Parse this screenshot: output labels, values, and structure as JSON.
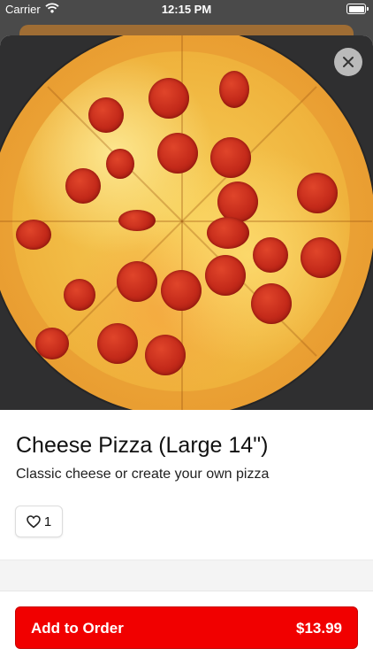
{
  "status_bar": {
    "carrier": "Carrier",
    "time": "12:15 PM",
    "icons": [
      "wifi-icon",
      "battery-icon"
    ]
  },
  "item": {
    "image_name": "pepperoni-pizza-photo",
    "title": "Cheese Pizza (Large 14\")",
    "description": "Classic cheese or create your own pizza",
    "like_count": "1"
  },
  "actions": {
    "close_icon": "close-icon",
    "add_to_order_label": "Add to Order",
    "price": "$13.99"
  },
  "colors": {
    "accent": "#f10000",
    "hero_background": "#2f2f30"
  }
}
